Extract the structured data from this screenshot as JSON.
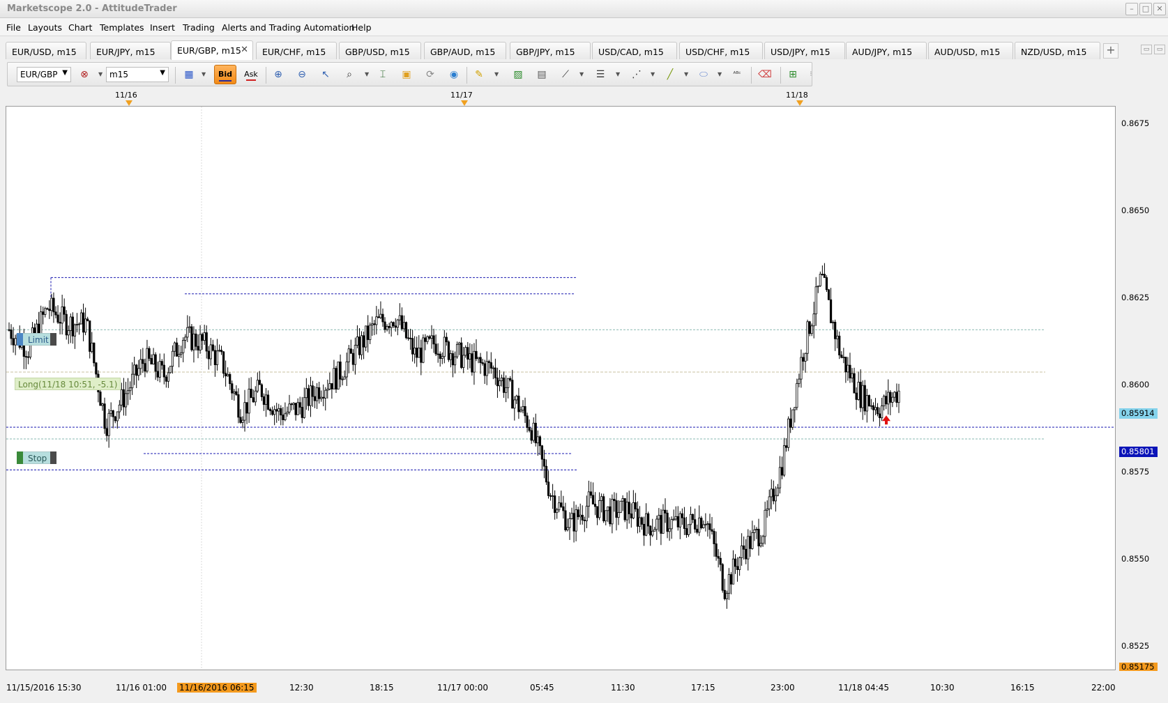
{
  "window": {
    "title": "Marketscope 2.0 - AttitudeTrader"
  },
  "menu": [
    "File",
    "Layouts",
    "Chart",
    "Templates",
    "Insert",
    "Trading",
    "Alerts and Trading Automation",
    "Help"
  ],
  "tabs": [
    {
      "label": "EUR/USD, m15",
      "active": false
    },
    {
      "label": "EUR/JPY, m15",
      "active": false
    },
    {
      "label": "EUR/GBP, m15",
      "active": true
    },
    {
      "label": "EUR/CHF, m15",
      "active": false
    },
    {
      "label": "GBP/USD, m15",
      "active": false
    },
    {
      "label": "GBP/AUD, m15",
      "active": false
    },
    {
      "label": "GBP/JPY, m15",
      "active": false
    },
    {
      "label": "USD/CAD, m15",
      "active": false
    },
    {
      "label": "USD/CHF, m15",
      "active": false
    },
    {
      "label": "USD/JPY, m15",
      "active": false
    },
    {
      "label": "AUD/JPY, m15",
      "active": false
    },
    {
      "label": "AUD/USD, m15",
      "active": false
    },
    {
      "label": "NZD/USD, m15",
      "active": false
    }
  ],
  "toolbar": {
    "instrument": "EUR/GBP",
    "timeframe": "m15",
    "bid_label": "Bid",
    "ask_label": "Ask"
  },
  "chart": {
    "date_markers": [
      "11/16",
      "11/17",
      "11/18"
    ],
    "price_ticks": [
      "0.8675",
      "0.8650",
      "0.8625",
      "0.8600",
      "0.8575",
      "0.8550",
      "0.8525"
    ],
    "current_bid": "0.85914",
    "stop_price": "0.85801",
    "low_price": "0.85175",
    "time_ticks": [
      "11/15/2016 15:30",
      "11/16 01:00",
      "11/16/2016 06:15",
      "12:30",
      "18:15",
      "11/17 00:00",
      "05:45",
      "11:30",
      "17:15",
      "23:00",
      "11/18 04:45",
      "10:30",
      "16:15",
      "22:00"
    ],
    "limit_label": "Limit",
    "stop_label": "Stop",
    "position_label": "Long(11/18 10:51, -5.1)",
    "colors": {
      "bid_tag": "#85d3ec",
      "stop_tag": "#0b14b8",
      "low_tag": "#f49a1e",
      "stop_line": "#1a1ab0",
      "limit_line": "#88b8b0",
      "entry_line": "#c8c0a0"
    }
  },
  "chart_data": {
    "type": "candlestick",
    "instrument": "EUR/GBP",
    "timeframe": "m15",
    "ylim": [
      0.8515,
      0.8685
    ],
    "grid": false,
    "x_range": [
      "11/15/2016 15:30",
      "11/18 22:00"
    ],
    "levels": {
      "stop": 0.85801,
      "current_bid": 0.85914,
      "low": 0.85175
    },
    "close_path": [
      {
        "t": "11/15 15:30",
        "price": 0.861
      },
      {
        "t": "11/15 16:00",
        "price": 0.8604
      },
      {
        "t": "11/15 18:00",
        "price": 0.8617
      },
      {
        "t": "11/15 21:00",
        "price": 0.8612
      },
      {
        "t": "11/16 00:00",
        "price": 0.8612
      },
      {
        "t": "11/16 01:00",
        "price": 0.8581
      },
      {
        "t": "11/16 02:30",
        "price": 0.859
      },
      {
        "t": "11/16 04:00",
        "price": 0.8601
      },
      {
        "t": "11/16 05:00",
        "price": 0.8596
      },
      {
        "t": "11/16 06:30",
        "price": 0.8608
      },
      {
        "t": "11/16 08:00",
        "price": 0.8606
      },
      {
        "t": "11/16 09:30",
        "price": 0.86
      },
      {
        "t": "11/16 11:00",
        "price": 0.8585
      },
      {
        "t": "11/16 12:30",
        "price": 0.8592
      },
      {
        "t": "11/16 14:00",
        "price": 0.8584
      },
      {
        "t": "11/16 15:30",
        "price": 0.8586
      },
      {
        "t": "11/16 17:00",
        "price": 0.8592
      },
      {
        "t": "11/16 18:15",
        "price": 0.8596
      },
      {
        "t": "11/16 20:00",
        "price": 0.8604
      },
      {
        "t": "11/16 22:00",
        "price": 0.8612
      },
      {
        "t": "11/17 00:00",
        "price": 0.8614
      },
      {
        "t": "11/17 01:30",
        "price": 0.8602
      },
      {
        "t": "11/17 03:00",
        "price": 0.8606
      },
      {
        "t": "11/17 04:30",
        "price": 0.8603
      },
      {
        "t": "11/17 05:45",
        "price": 0.86
      },
      {
        "t": "11/17 07:00",
        "price": 0.8598
      },
      {
        "t": "11/17 08:30",
        "price": 0.859
      },
      {
        "t": "11/17 09:30",
        "price": 0.858
      },
      {
        "t": "11/17 10:30",
        "price": 0.856
      },
      {
        "t": "11/17 11:30",
        "price": 0.855
      },
      {
        "t": "11/17 13:30",
        "price": 0.8557
      },
      {
        "t": "11/17 15:30",
        "price": 0.8554
      },
      {
        "t": "11/17 17:15",
        "price": 0.8555
      },
      {
        "t": "11/17 19:00",
        "price": 0.855
      },
      {
        "t": "11/17 21:00",
        "price": 0.8551
      },
      {
        "t": "11/17 23:00",
        "price": 0.855
      },
      {
        "t": "11/18 00:30",
        "price": 0.8553
      },
      {
        "t": "11/18 02:00",
        "price": 0.8531
      },
      {
        "t": "11/18 03:00",
        "price": 0.8543
      },
      {
        "t": "11/18 04:45",
        "price": 0.8549
      },
      {
        "t": "11/18 05:45",
        "price": 0.857
      },
      {
        "t": "11/18 06:45",
        "price": 0.8602
      },
      {
        "t": "11/18 07:45",
        "price": 0.8626
      },
      {
        "t": "11/18 08:30",
        "price": 0.8602
      },
      {
        "t": "11/18 09:30",
        "price": 0.859
      },
      {
        "t": "11/18 10:30",
        "price": 0.8586
      },
      {
        "t": "11/18 11:15",
        "price": 0.8591
      }
    ]
  }
}
